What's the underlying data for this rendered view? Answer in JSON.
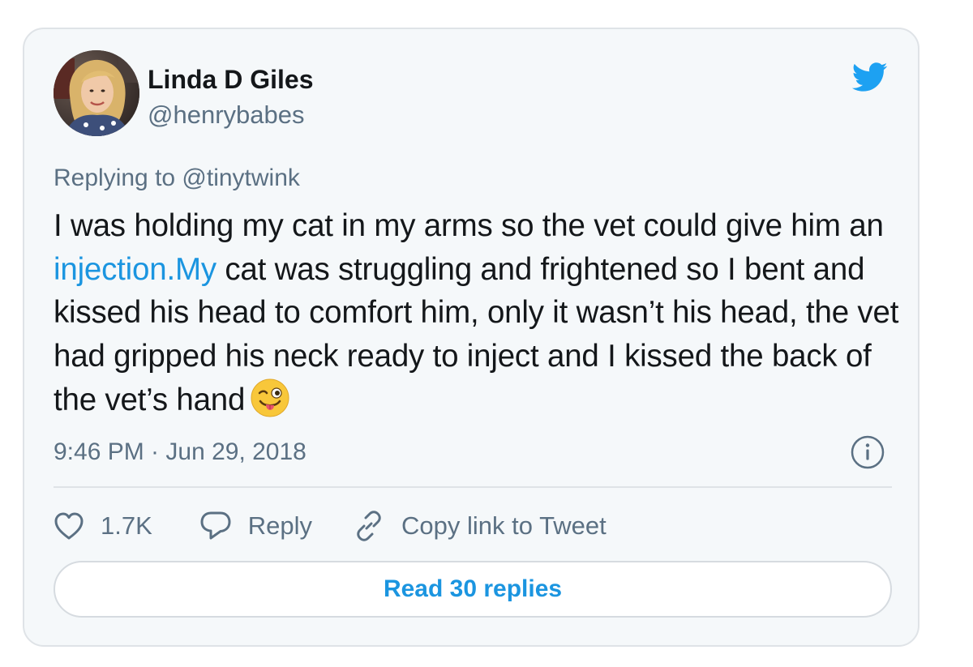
{
  "tweet": {
    "author": {
      "name": "Linda D Giles",
      "handle": "@henrybabes"
    },
    "replying_to": "Replying to @tinytwink",
    "text": {
      "part1": "I was holding my cat in my arms so the vet could give him an ",
      "link": "injection.My",
      "part2": " cat was struggling and frightened so I bent and kissed his head to comfort him, only it wasn’t his head, the vet had gripped his neck ready to inject and I kissed the back of the vet’s hand"
    },
    "emoji": "winking-face-with-tongue",
    "timestamp": "9:46 PM · Jun 29, 2018",
    "actions": {
      "likes": "1.7K",
      "reply_label": "Reply",
      "copy_link_label": "Copy link to Tweet"
    },
    "read_replies_label": "Read 30 replies"
  },
  "colors": {
    "card_background": "#f5f8fa",
    "brand_blue": "#1b95e0",
    "twitter_bird": "#1da1f2",
    "secondary_text": "#5b7083",
    "primary_text": "#14171a",
    "border": "#dfe3e7"
  },
  "icons": {
    "brand": "twitter-bird-icon",
    "info": "info-icon",
    "like": "heart-icon",
    "reply": "speech-bubble-icon",
    "copy_link": "link-icon"
  }
}
